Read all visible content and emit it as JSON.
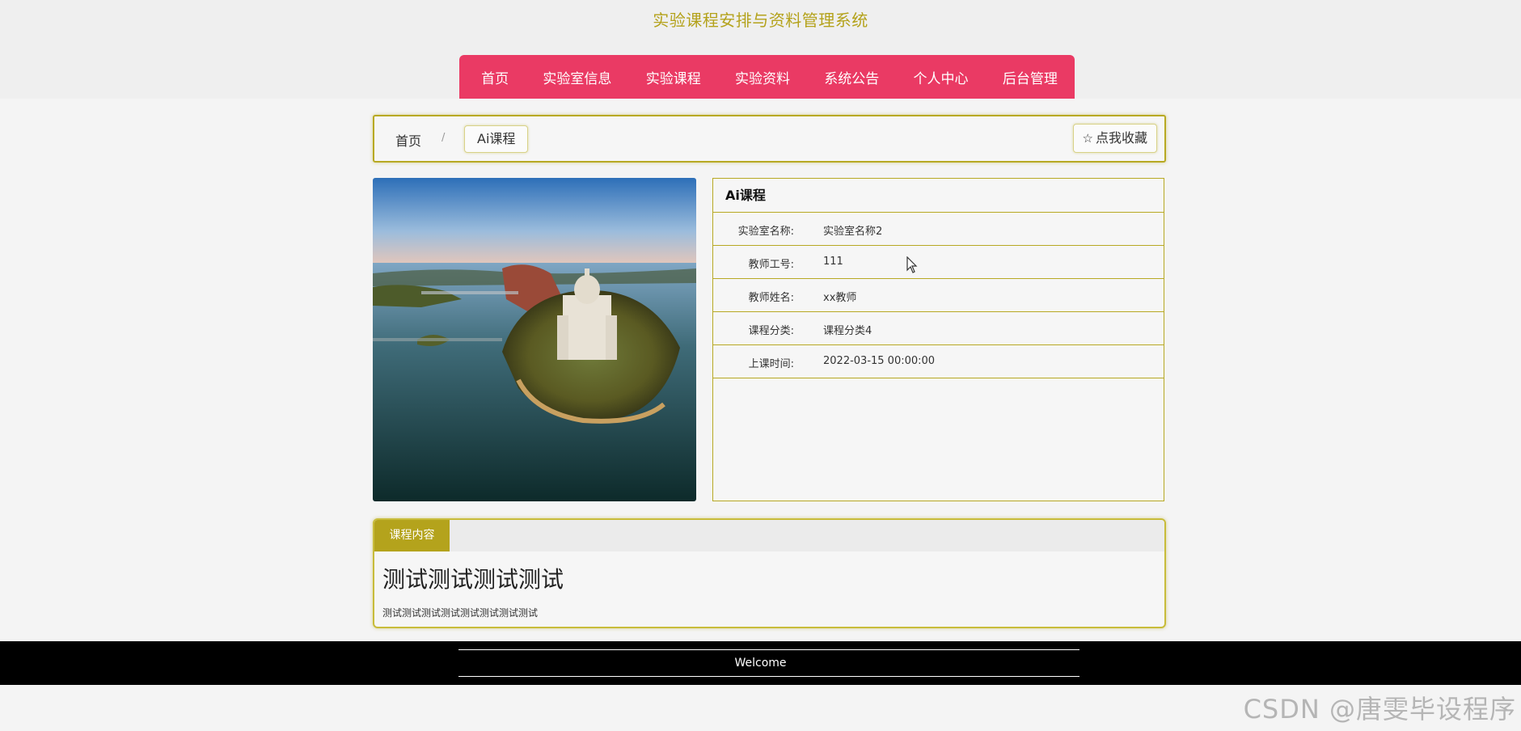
{
  "site": {
    "title": "实验课程安排与资料管理系统"
  },
  "nav": {
    "items": [
      {
        "label": "首页"
      },
      {
        "label": "实验室信息"
      },
      {
        "label": "实验课程"
      },
      {
        "label": "实验资料"
      },
      {
        "label": "系统公告"
      },
      {
        "label": "个人中心"
      },
      {
        "label": "后台管理"
      }
    ]
  },
  "breadcrumb": {
    "home": "首页",
    "separator": "/",
    "current": "Ai课程"
  },
  "favorite": {
    "icon": "star-outline-icon",
    "label": "点我收藏"
  },
  "detail": {
    "title": "Ai课程",
    "rows": [
      {
        "label": "实验室名称:",
        "value": "实验室名称2"
      },
      {
        "label": "教师工号:",
        "value": "111"
      },
      {
        "label": "教师姓名:",
        "value": "xx教师"
      },
      {
        "label": "课程分类:",
        "value": "课程分类4"
      },
      {
        "label": "上课时间:",
        "value": "2022-03-15 00:00:00"
      }
    ]
  },
  "content": {
    "tab": "课程内容",
    "heading": "测试测试测试测试",
    "text": "测试测试测试测试测试测试测试测试"
  },
  "footer": {
    "text": "Welcome"
  },
  "watermark": "CSDN @唐雯毕设程序",
  "colors": {
    "accent": "#b4a31c",
    "nav": "#ea3a64",
    "footer": "#000000"
  }
}
